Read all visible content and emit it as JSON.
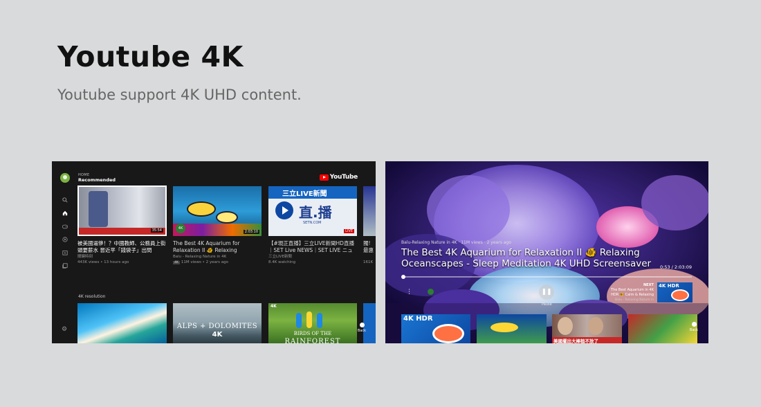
{
  "page": {
    "title": "Youtube 4K",
    "subtitle": "Youtube support 4K UHD content."
  },
  "home_screen": {
    "section_label": "HOME",
    "section_title": "Recommended",
    "logo_text": "YouTube",
    "nav_icons": [
      "search-icon",
      "home-icon",
      "gaming-icon",
      "subscriptions-icon",
      "library-icon",
      "queue-icon"
    ],
    "settings_icon": "gear-icon",
    "recommended": [
      {
        "title": "被美國逼慘！？中國教師、公務員上街頭要薪水 習近平「錢袋子」出問",
        "channel": "關鍵時刻",
        "meta": "443K views • 13 hours ago",
        "duration": "35:54"
      },
      {
        "title": "The Best 4K Aquarium for Relaxation II 🐠 Relaxing",
        "channel": "Balu - Relaxing Nature in 4K",
        "badge": "4K",
        "meta": "11M views • 2 years ago",
        "duration": "2:03:10"
      },
      {
        "title": "【#現正直播】三立LIVE新聞HD直播｜SET Live NEWS｜SET LIVE ニュ",
        "channel": "三立LIVE新聞",
        "meta": "8.4K watching",
        "thumb_text": "三立LIVE新聞",
        "thumb_big": "直.播",
        "thumb_url": "SETN.COM",
        "live_badge": "LIVE"
      },
      {
        "title": "獨!",
        "title2": "最惠",
        "meta": "161K"
      }
    ],
    "shelf_label": "4K resolution",
    "shelf": [
      {
        "text": ""
      },
      {
        "text": "ALPS + DOLOMITES",
        "text2": "4K"
      },
      {
        "text": "4K",
        "text2": "BIRDS OF THE",
        "text3": "RAINFOREST"
      }
    ],
    "back_label": "Back"
  },
  "player_screen": {
    "channel_line": "Balu-Relaxing Nature in 4K · 11M views · 2 years ago",
    "title": "The Best 4K Aquarium for Relaxation II 🐠 Relaxing Oceanscapes - Sleep Meditation 4K UHD Screensaver",
    "time": "0:53 / 2:03:09",
    "progress": 0.007,
    "pause_label": "Pause",
    "next_label": "NEXT",
    "next_title": "The Best Aquarium in 4K HDR 🐠 Calm & Relaxing",
    "next_channel": "Balu - Relaxing Nature in",
    "next_badge": "4K HDR",
    "row": [
      {
        "label": "4K HDR"
      },
      {
        "label": ""
      },
      {
        "label": "美國擺出大棒槌不放了"
      },
      {
        "label": ""
      }
    ],
    "back_label": "Back"
  }
}
